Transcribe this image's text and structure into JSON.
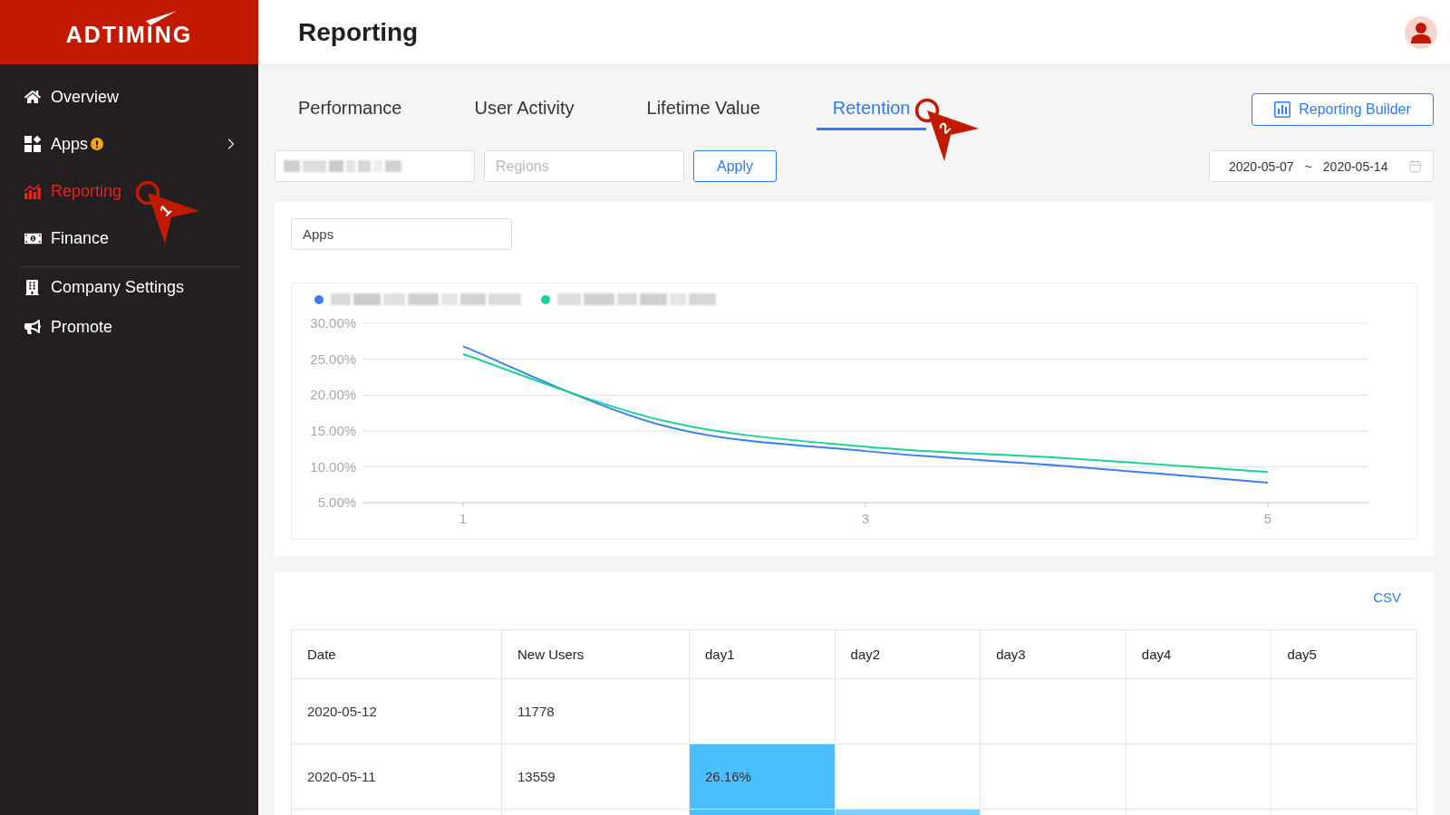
{
  "sidebar": {
    "logo": "ADTIMING",
    "sections": [
      {
        "items": [
          {
            "label": "Overview",
            "selected": false,
            "alert": false,
            "submenu": false
          },
          {
            "label": "Apps",
            "selected": false,
            "alert": true,
            "submenu": true
          },
          {
            "label": "Reporting",
            "selected": true,
            "alert": false,
            "submenu": false,
            "callout": "1"
          },
          {
            "label": "Finance",
            "selected": false,
            "alert": false,
            "submenu": false
          }
        ]
      },
      {
        "items": [
          {
            "label": "Company Settings",
            "selected": false,
            "alert": false,
            "submenu": false
          },
          {
            "label": "Promote",
            "selected": false,
            "alert": false,
            "submenu": false
          }
        ]
      }
    ]
  },
  "header": {
    "title": "Reporting"
  },
  "tabs": [
    {
      "label": "Performance",
      "selected": false
    },
    {
      "label": "User Activity",
      "selected": false
    },
    {
      "label": "Lifetime Value",
      "selected": false
    },
    {
      "label": "Retention",
      "selected": true,
      "callout": "2"
    }
  ],
  "builder_button": {
    "label": "Reporting Builder"
  },
  "filters": [
    {
      "kind": "redacted"
    },
    {
      "kind": "select",
      "placeholder": "Regions"
    }
  ],
  "apply_button": {
    "label": "Apply"
  },
  "date_range": {
    "start": "2020-05-07",
    "separator": "~",
    "end": "2020-05-14"
  },
  "chart": {
    "group_by": "Apps",
    "chart_data": {
      "type": "line",
      "grid": true,
      "x": [
        1,
        2,
        3,
        4,
        5
      ],
      "xlim": [
        0.5,
        5.5
      ],
      "ylim": [
        5,
        30
      ],
      "xticks": [
        1,
        3,
        5
      ],
      "yticks": [
        {
          "value": 5,
          "label": "5.00%"
        },
        {
          "value": 10,
          "label": "10.00%"
        },
        {
          "value": 15,
          "label": "15.00%"
        },
        {
          "value": 20,
          "label": "20.00%"
        },
        {
          "value": 25,
          "label": "25.00%"
        },
        {
          "value": 30,
          "label": "30.00%"
        }
      ],
      "series": [
        {
          "color": "#3b7ef6",
          "values": [
            26.8,
            15.7,
            12.2,
            10.1,
            7.8
          ]
        },
        {
          "color": "#17d494",
          "values": [
            25.7,
            16.4,
            12.8,
            11.2,
            9.3
          ]
        }
      ]
    }
  },
  "table": {
    "export_link": "CSV",
    "columns": [
      "Date",
      "New Users",
      "day1",
      "day2",
      "day3",
      "day4",
      "day5"
    ],
    "rows": [
      {
        "date": "2020-05-12",
        "new_users": "11778"
      },
      {
        "date": "2020-05-11",
        "new_users": "13559",
        "days": [
          {
            "value": "26.16%",
            "color": "#4cbefd"
          }
        ]
      },
      {
        "days": [
          {
            "color": "#4cbefd"
          },
          {
            "color": "#7fd0fd"
          }
        ]
      }
    ]
  }
}
